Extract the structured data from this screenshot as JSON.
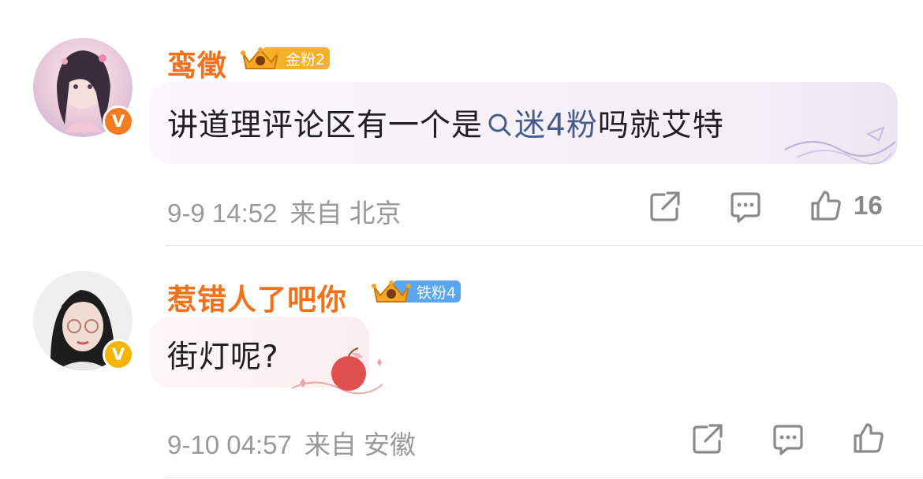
{
  "comments": [
    {
      "username": "鸾徵",
      "fan_badge": "金粉2",
      "text_before": "讲道理评论区有一个是",
      "search_term": "迷4粉",
      "text_after": "吗就艾特",
      "time": "9-9 14:52",
      "location": "来自 北京",
      "likes": "16",
      "badge_color": "#f5b12a",
      "verified_color": "#f47c20"
    },
    {
      "username": "惹错人了吧你",
      "fan_badge": "铁粉4",
      "text": "街灯呢?",
      "time": "9-10 04:57",
      "location": "来自 安徽",
      "badge_color": "#5aa7f0",
      "verified_color": "#f5b400"
    }
  ],
  "icons": [
    "share-icon",
    "comment-icon",
    "like-icon",
    "search-icon",
    "crown-icon"
  ]
}
